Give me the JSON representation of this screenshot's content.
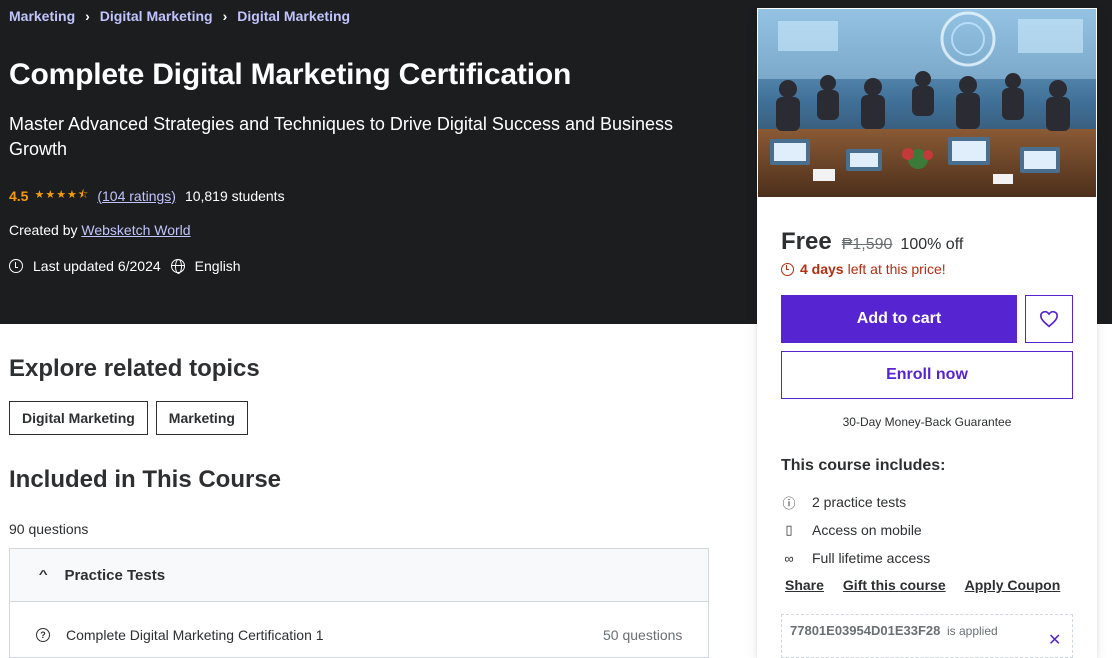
{
  "breadcrumb": [
    "Marketing",
    "Digital Marketing",
    "Digital Marketing"
  ],
  "course": {
    "title": "Complete Digital Marketing Certification",
    "subtitle": "Master Advanced Strategies and Techniques to Drive Digital Success and Business Growth",
    "rating": "4.5",
    "stars_value": 4.5,
    "ratings_count": "(104 ratings)",
    "students": "10,819 students",
    "created_by_label": "Created by",
    "author": "Websketch World",
    "last_updated": "Last updated 6/2024",
    "language": "English"
  },
  "card": {
    "price": "Free",
    "original_price": "₱1,590",
    "discount": "100% off",
    "timer_bold": "4 days",
    "timer_rest": "left at this price!",
    "add_to_cart": "Add to cart",
    "enroll": "Enroll now",
    "guarantee": "30-Day Money-Back Guarantee",
    "includes_title": "This course includes:",
    "includes": [
      {
        "icon": "question-circle-icon",
        "label": "2 practice tests"
      },
      {
        "icon": "mobile-icon",
        "label": "Access on mobile"
      },
      {
        "icon": "infinity-icon",
        "label": "Full lifetime access"
      }
    ],
    "links": [
      "Share",
      "Gift this course",
      "Apply Coupon"
    ],
    "coupon_code": "77801E03954D01E33F28",
    "coupon_status": "is applied"
  },
  "related": {
    "title": "Explore related topics",
    "topics": [
      "Digital Marketing",
      "Marketing"
    ]
  },
  "included": {
    "title": "Included in This Course",
    "questions": "90 questions",
    "section_title": "Practice Tests",
    "items": [
      {
        "title": "Complete Digital Marketing Certification 1",
        "count": "50 questions"
      }
    ]
  },
  "colors": {
    "hero_bg": "#1c1d1f",
    "accent": "#5624d0",
    "link_light": "#c0c4fc",
    "star": "#f69c08",
    "timer": "#b32d0f"
  }
}
